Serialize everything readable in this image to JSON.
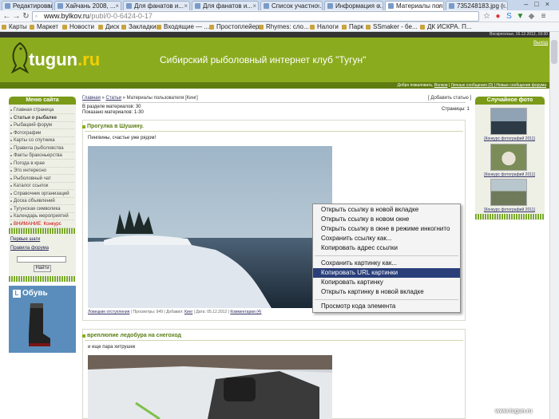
{
  "browser": {
    "tabs": [
      {
        "label": "Редактирование",
        "active": false
      },
      {
        "label": "Хайчань 2008, ...",
        "active": false
      },
      {
        "label": "Для фанатов и...",
        "active": false
      },
      {
        "label": "Для фанатов и...",
        "active": false
      },
      {
        "label": "Список участно...",
        "active": false
      },
      {
        "label": "Информация о...",
        "active": false
      },
      {
        "label": "Материалы пол...",
        "active": true
      },
      {
        "label": "735248183.jpg (...",
        "active": false
      }
    ],
    "url_host": "www.bylkov.ru",
    "url_path": "/publ/0-0-6424-0-17",
    "bookmarks": [
      "Карты",
      "Маркет",
      "Новости",
      "Диск",
      "Закладки",
      "Входящие — ...",
      "Простоплейер",
      "Rhymes: сло...",
      "Налоги",
      "Парк",
      "SSmaker - бе...",
      "ДК ИСКРА. П..."
    ]
  },
  "site": {
    "date_line": "Воскресенье, 16.12.2012, 19:30",
    "logo_text": "tugun",
    "logo_domain": ".ru",
    "title": "Сибирский рыболовный интернет клуб \"Тугун\"",
    "header_link": "Выход",
    "userbar": {
      "greeting": "Добро пожаловать,",
      "user": "Волков",
      "links": "Личные сообщения (0) | Новые сообщения форума"
    }
  },
  "left_menu": {
    "heading": "Меню сайта",
    "items": [
      {
        "label": "Главная страница",
        "style": ""
      },
      {
        "label": "Статьи о рыбалке",
        "style": "bold"
      },
      {
        "label": "Рыбацкий форум",
        "style": ""
      },
      {
        "label": "Фотографии",
        "style": ""
      },
      {
        "label": "Карты со спутника",
        "style": ""
      },
      {
        "label": "Правила рыболовства",
        "style": ""
      },
      {
        "label": "Факты браконьерства",
        "style": ""
      },
      {
        "label": "Погода в крае",
        "style": ""
      },
      {
        "label": "Это интересно",
        "style": ""
      },
      {
        "label": "Рыболовный чат",
        "style": ""
      },
      {
        "label": "Каталог ссылок",
        "style": ""
      },
      {
        "label": "Справочник организаций",
        "style": ""
      },
      {
        "label": "Доска объявлений",
        "style": ""
      },
      {
        "label": "Тугунская символика",
        "style": ""
      },
      {
        "label": "Календарь мероприятий",
        "style": ""
      },
      {
        "label": "ВНИМАНИЕ: Конкурс",
        "style": "red"
      }
    ],
    "extra_links": [
      "Первые шаги",
      "Правила форума"
    ],
    "search_button": "Найти",
    "ad_title": "Обувь"
  },
  "main": {
    "breadcrumb_home": "Главная",
    "breadcrumb_section": "Статьи",
    "breadcrumb_current": "» Материалы пользователя [Кинг]",
    "add_material": "[ Добавить статью ]",
    "stats_in_section": "В разделе материалов: 30",
    "stats_shown": "Показано материалов: 1-30",
    "pages": "Страницы: 1",
    "posts": [
      {
        "title": "Прогулка в Шушину.",
        "text": "Пингвины, счастье уже рядом!",
        "footer_category": "Ловецкие отступления",
        "footer_meta": " | Просмотры: 949 | Добавил: ",
        "footer_author": "Кинг",
        "footer_date": " | Дата: 05.12.2012 | ",
        "footer_comments": "Комментарии (4)"
      },
      {
        "title": "вреплюпие ледобура на снегоход",
        "text": "и еще пара хитрушек"
      }
    ]
  },
  "right_col": {
    "heading": "Случайное фото",
    "captions": [
      "[Конкурс фотографий 2011]",
      "[Конкурс фотографий 2011]",
      "[Конкурс фотографий 2011]"
    ]
  },
  "context_menu": {
    "group1": [
      "Открыть ссылку в новой вкладке",
      "Открыть ссылку в новом окне",
      "Открыть ссылку в окне в режиме инкогнито",
      "Сохранить ссылку как...",
      "Копировать адрес ссылки"
    ],
    "group2": [
      "Сохранить картинку как...",
      "Копировать URL картинки",
      "Копировать картинку",
      "Открыть картинку в новой вкладке"
    ],
    "group3": [
      "Просмотр кода элемента"
    ],
    "highlighted": "Копировать URL картинки"
  },
  "watermark": "www.tugun.ru",
  "colors": {
    "brand_green": "#8bab1f",
    "menu_highlight": "#2a3f7a"
  }
}
